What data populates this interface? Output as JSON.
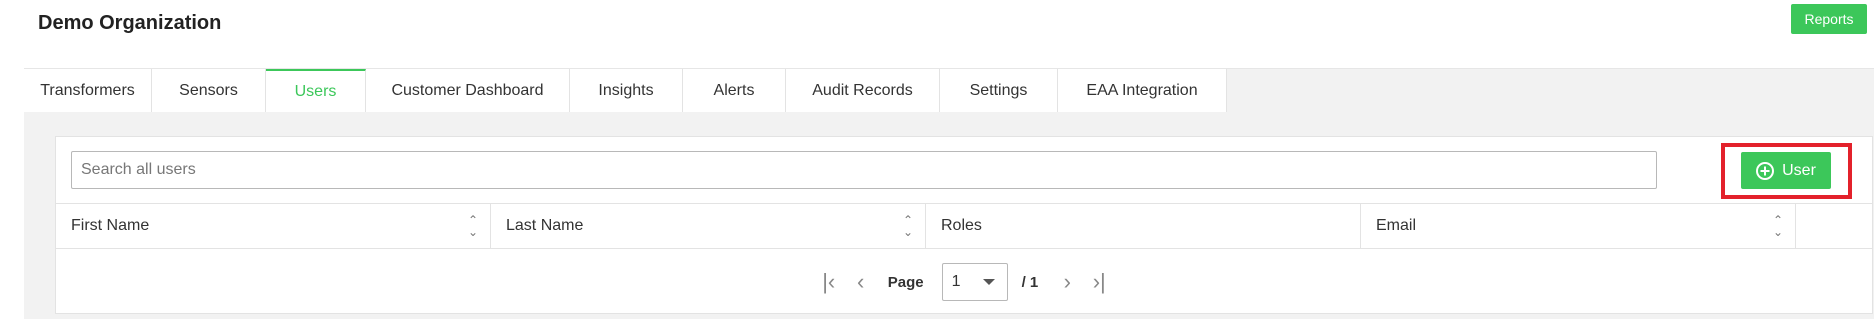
{
  "header": {
    "org_title": "Demo Organization",
    "reports_label": "Reports"
  },
  "tabs": [
    {
      "label": "Transformers",
      "active": false
    },
    {
      "label": "Sensors",
      "active": false
    },
    {
      "label": "Users",
      "active": true
    },
    {
      "label": "Customer Dashboard",
      "active": false
    },
    {
      "label": "Insights",
      "active": false
    },
    {
      "label": "Alerts",
      "active": false
    },
    {
      "label": "Audit Records",
      "active": false
    },
    {
      "label": "Settings",
      "active": false
    },
    {
      "label": "EAA Integration",
      "active": false
    }
  ],
  "users_panel": {
    "search_placeholder": "Search all users",
    "search_value": "",
    "add_user_label": "User",
    "columns": [
      {
        "label": "First Name",
        "sortable": true
      },
      {
        "label": "Last Name",
        "sortable": true
      },
      {
        "label": "Roles",
        "sortable": false
      },
      {
        "label": "Email",
        "sortable": true
      }
    ],
    "rows": [],
    "pagination": {
      "page_label": "Page",
      "current_page": "1",
      "total_pages_label": "/ 1"
    }
  },
  "icons": {
    "first_page": "first-page-icon",
    "prev_page": "prev-page-icon",
    "next_page": "next-page-icon",
    "last_page": "last-page-icon",
    "add": "plus-circle-icon",
    "sort": "sort-icon",
    "dropdown": "chevron-down-icon"
  },
  "colors": {
    "accent": "#3cc75a",
    "highlight": "#e3212b"
  }
}
